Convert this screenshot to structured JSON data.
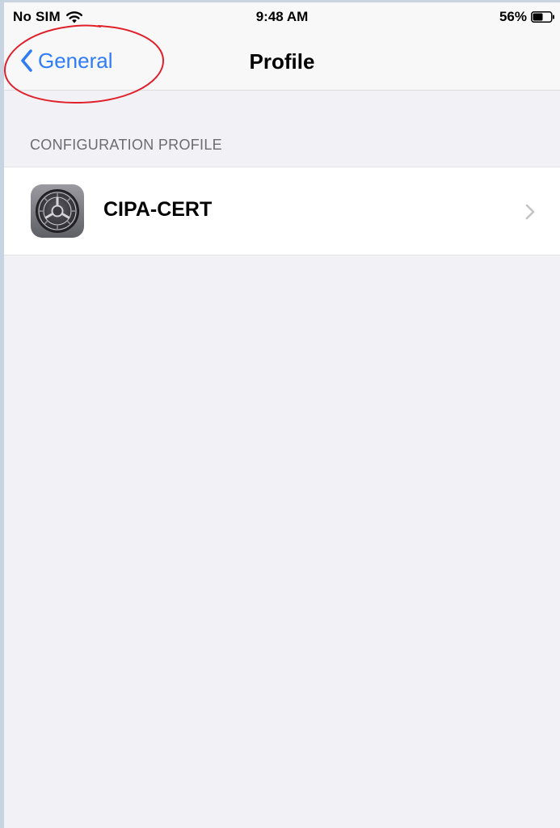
{
  "status_bar": {
    "carrier": "No SIM",
    "time": "9:48 AM",
    "battery_percent": "56%",
    "battery_level": 0.56,
    "wifi_icon": "wifi-icon",
    "battery_icon": "battery-icon"
  },
  "nav": {
    "back_label": "General",
    "title": "Profile",
    "back_icon": "chevron-left-icon",
    "accent_color": "#2f7cf6"
  },
  "section": {
    "header": "CONFIGURATION PROFILE"
  },
  "profile": {
    "name": "CIPA-CERT",
    "icon": "settings-gear-icon",
    "disclosure_icon": "chevron-right-icon"
  },
  "annotation": {
    "color": "#e0202a"
  }
}
